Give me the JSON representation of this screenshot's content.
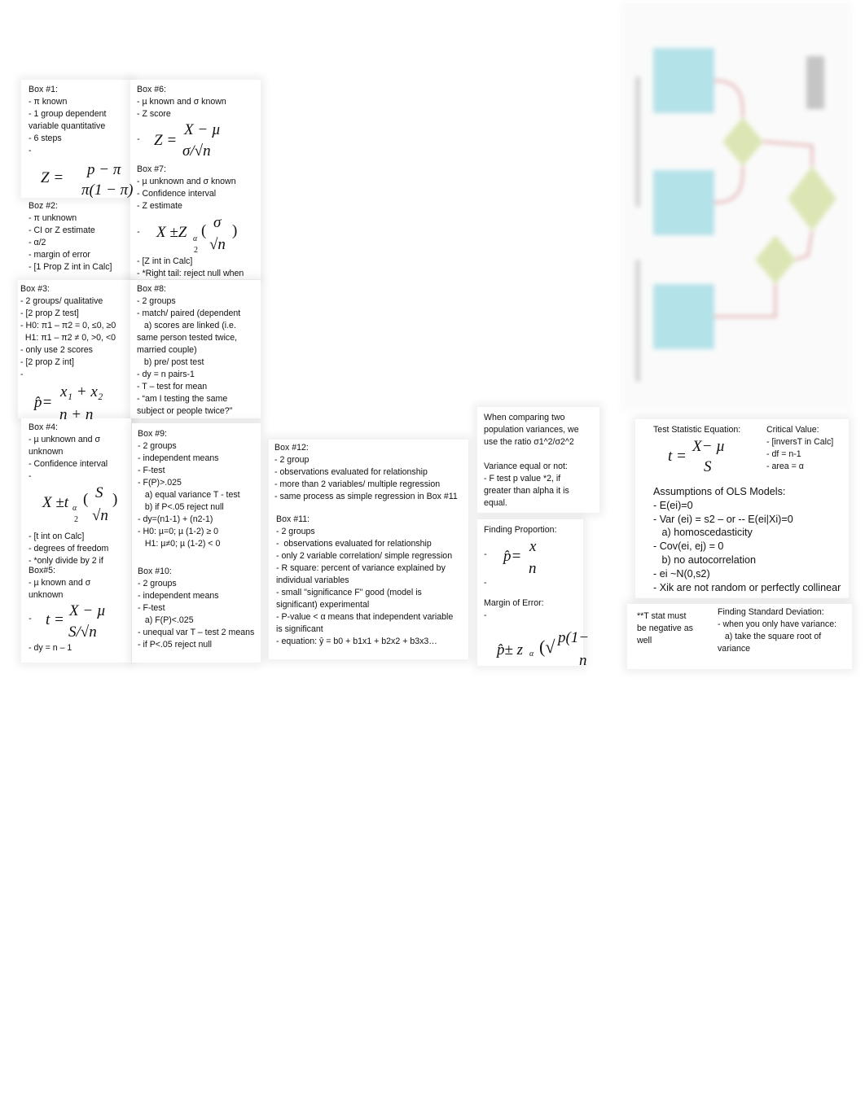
{
  "boxes": [
    {
      "id": "box-1",
      "lines": [
        "Box #1:",
        "- π known",
        "- 1 group dependent",
        "variable quantitative",
        "- 6 steps",
        "-"
      ]
    },
    {
      "id": "box-2",
      "lines": [
        "Boz #2:",
        "- π unknown",
        "- CI or Z estimate",
        "- α/2",
        "- margin of error",
        "- [1 Prop Z int in Calc]"
      ]
    },
    {
      "id": "box-3",
      "lines": [
        "Box #3:",
        "- 2 groups/ qualitative",
        "- [2 prop Z test]",
        "- H0: π1 – π2 = 0, ≤0, ≥0",
        "  H1: π1 – π2 ≠ 0, >0, <0",
        "- only use 2 scores",
        "- [2 prop Z int]",
        "-"
      ]
    },
    {
      "id": "box-4a",
      "lines": [
        "Box #4:",
        "- µ unknown and σ",
        "unknown",
        "- Confidence interval",
        "-"
      ]
    },
    {
      "id": "box-4b",
      "lines": [
        "- [t int on Calc]",
        "- degrees of freedom",
        "- *only divide by 2 if"
      ]
    },
    {
      "id": "box-5a",
      "lines": [
        "Box#5:",
        "- µ known and σ",
        "unknown"
      ]
    },
    {
      "id": "box-5b",
      "lines": [
        "- dy = n – 1"
      ]
    },
    {
      "id": "box-6",
      "lines": [
        "Box #6:",
        "- µ known and σ known",
        "- Z score"
      ]
    },
    {
      "id": "box-7a",
      "lines": [
        "Box #7:",
        "- µ unknown and σ known",
        "- Confidence interval",
        "- Z estimate"
      ]
    },
    {
      "id": "box-7b",
      "lines": [
        "- [Z int in Calc]",
        "- *Right tail: reject null when"
      ]
    },
    {
      "id": "box-8",
      "lines": [
        "Box #8:",
        "- 2 groups",
        "- match/ paired (dependent",
        "   a) scores are linked (i.e.",
        "same person tested twice,",
        "married couple)",
        "   b) pre/ post test",
        "- dy = n pairs-1",
        "- T – test for mean",
        "- “am I testing the same",
        "subject or people twice?\""
      ]
    },
    {
      "id": "box-9",
      "lines": [
        "Box #9:",
        "- 2 groups",
        "- independent means",
        "- F-test",
        "- F(P)>.025",
        "   a) equal variance T - test",
        "   b) if P<.05 reject null",
        "- dy=(n1-1) + (n2-1)",
        "- H0: µ=0; µ (1-2) ≥ 0",
        "   H1: µ≠0; µ (1-2) < 0"
      ]
    },
    {
      "id": "box-10",
      "lines": [
        "Box #10:",
        "- 2 groups",
        "- independent means",
        "- F-test",
        "   a) F(P)<.025",
        "- unequal var T – test 2 means",
        "- if P<.05 reject null"
      ]
    },
    {
      "id": "box-12",
      "lines": [
        "Box #12:",
        "- 2 group",
        "- observations evaluated for relationship",
        "- more than 2 variables/ multiple regression",
        "- same process as simple regression in Box #11"
      ]
    },
    {
      "id": "box-11",
      "lines": [
        "Box #11:",
        "- 2 groups",
        "-  observations evaluated for relationship",
        "- only 2 variable correlation/ simple regression",
        "- R square: percent of variance explained by",
        "individual variables",
        "- small \"significance F\" good (model is",
        "significant) experimental",
        "- P-value < α means that independent variable",
        "is significant",
        "- equation: ŷ = b0 + b1x1 + b2x2 + b3x3…"
      ]
    },
    {
      "id": "comparing-variances",
      "lines": [
        "When comparing two",
        "population variances, we",
        "use the ratio σ1^2/σ2^2"
      ]
    },
    {
      "id": "variance-equal",
      "lines": [
        "Variance equal or not:",
        "- F test p value *2, if",
        "greater than alpha it is",
        "equal."
      ]
    },
    {
      "id": "finding-proportion",
      "lines": [
        "Finding Proportion:"
      ]
    },
    {
      "id": "finding-proportion-end",
      "lines": [
        "-"
      ]
    },
    {
      "id": "margin-of-error",
      "lines": [
        "Margin of Error:",
        "-"
      ]
    },
    {
      "id": "test-statistic",
      "lines": [
        "Test Statistic Equation:"
      ]
    },
    {
      "id": "critical-value",
      "lines": [
        "Critical Value:",
        "- [inversT in Calc]",
        "- df = n-1",
        "- area = α"
      ]
    },
    {
      "id": "assumptions-ols",
      "lines": [
        "Assumptions of OLS Models:",
        "- E(ei)=0",
        "- Var (ei) = s2 – or -- E(ei|Xi)=0",
        "   a) homoscedasticity",
        "- Cov(ei, ej) = 0",
        "   b) no autocorrelation",
        "- ei ~N(0,s2)",
        "- Xik are not random or perfectly collinear"
      ]
    },
    {
      "id": "t-stat-note",
      "lines": [
        "**T stat must",
        "be negative as",
        "well"
      ]
    },
    {
      "id": "finding-sd",
      "lines": [
        "Finding Standard Deviation:",
        "- when you only have variance:",
        "   a) take the square root of",
        "variance"
      ]
    }
  ],
  "formulas": {
    "f1": {
      "lhs": "Z =",
      "num": "p − π",
      "den": "π(1 − π)"
    },
    "f6": {
      "dash": "-",
      "lhs": "Z =",
      "num": "X − µ",
      "den": "σ/√n"
    },
    "f7": {
      "dash": "-",
      "lhs": "X ±Z",
      "sub": "α",
      "sub2": "2",
      "open": "(",
      "num": "σ",
      "den": "√n",
      "close": ")"
    },
    "f3": {
      "lhs": "p̂=",
      "num": "x₁ + x₂",
      "den": "n + n"
    },
    "f4": {
      "lhs": "X ±t",
      "sub": "α",
      "sub2": "2",
      "open": "(",
      "num": "S",
      "den": "√n",
      "close": ")"
    },
    "f5": {
      "dash": "-",
      "lhs": "t =",
      "num": "X − µ",
      "den": "S/√n"
    },
    "fp": {
      "dash": "-",
      "lhs": "p̂=",
      "num": "x",
      "den": "n"
    },
    "fm": {
      "lhs": "p̂± z",
      "sub": "α",
      "num": "p(1−",
      "den": "n",
      "open": "(√"
    },
    "ft": {
      "lhs": "t =",
      "num": "X− µ",
      "den": "S"
    }
  },
  "flowchart": {
    "box_color": "#a8dde6",
    "decision_color": "#d6e2a8",
    "arrow_color": "#e0a8a8"
  }
}
